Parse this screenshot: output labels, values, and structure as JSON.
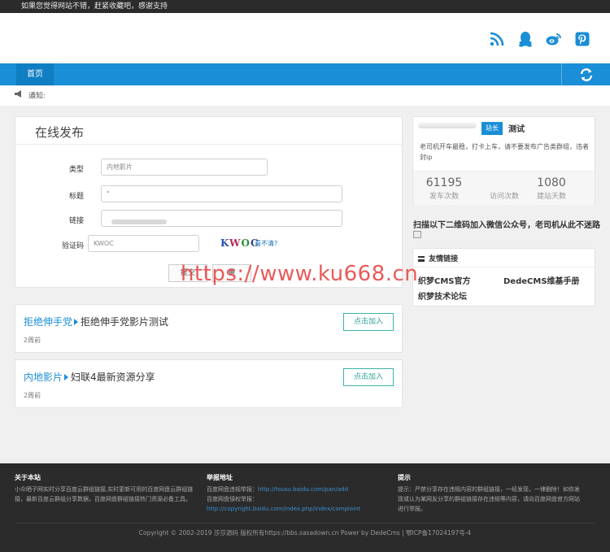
{
  "topbar": {
    "message": "如果您觉得网站不错，赶紧收藏吧，感谢支持"
  },
  "header": {
    "icons": [
      "rss-icon",
      "qq-icon",
      "weibo-icon",
      "pinterest-icon"
    ]
  },
  "nav": {
    "home": "首页"
  },
  "notice": {
    "label": "通知:"
  },
  "publish": {
    "title": "在线发布",
    "fields": {
      "type_label": "类型",
      "type_value": "内地影片",
      "title_label": "标题",
      "title_value": "\"",
      "link_label": "链接",
      "captcha_label": "验证码",
      "captcha_value": "KWOC",
      "captcha_chars": [
        "K",
        "W",
        "O",
        "C"
      ],
      "captcha_refresh": "看不清?"
    },
    "submit": "提交",
    "reset": "重"
  },
  "posts": [
    {
      "category": "拒绝伸手党",
      "title": "拒绝伸手党影片测试",
      "time": "2周前",
      "button": "点击加入"
    },
    {
      "category": "内地影片",
      "title": "妇联4最新资源分享",
      "time": "2周前",
      "button": "点击加入"
    }
  ],
  "profile": {
    "role": "站长",
    "name": "测试",
    "bio": "老司机开车最稳，打卡上车，请不要发布广告类群组，违者封ip",
    "stats": [
      {
        "num": "61195",
        "label": "发车次数"
      },
      {
        "num": "",
        "label": "访问次数"
      },
      {
        "num": "1080",
        "label": "建站天数"
      }
    ]
  },
  "qr": {
    "text": "扫描以下二维码加入微信公众号，老司机从此不迷路"
  },
  "links": {
    "heading": "友情链接",
    "items": [
      "织梦CMS官方",
      "DedeCMS维基手册",
      "织梦技术论坛"
    ]
  },
  "watermark": "https://www.ku668.cn",
  "footer": {
    "about_title": "关于本站",
    "about_text": "小众晒子网实时分享百度云群组链接,实时更新可用的百度网盘云群组链接，最新百度云群组分享数据，百度网盘群组链接热门资源必备工具。",
    "report_title": "举报地址",
    "report_line1": "百度网盘违规举报：",
    "report_link1": "http://tousu.baidu.com/pan/add",
    "report_line2": "百度网盘侵权举报：",
    "report_link2": "http://copyright.baidu.com/index.php/index/complaint",
    "tip_title": "提示",
    "tip_text": "提示：严禁分享存在违规内容的群组链接，一经发现，一律删除！如你发现或认为某网友分享的群组链接存在违规等内容，请向百度网盘官方网站进行举报。",
    "copyright": "Copyright © 2002-2019 莎莎源码 版权所有https://bbs.sasadown.cn Power by DedeCms | 鄂ICP备17024197号-4"
  }
}
